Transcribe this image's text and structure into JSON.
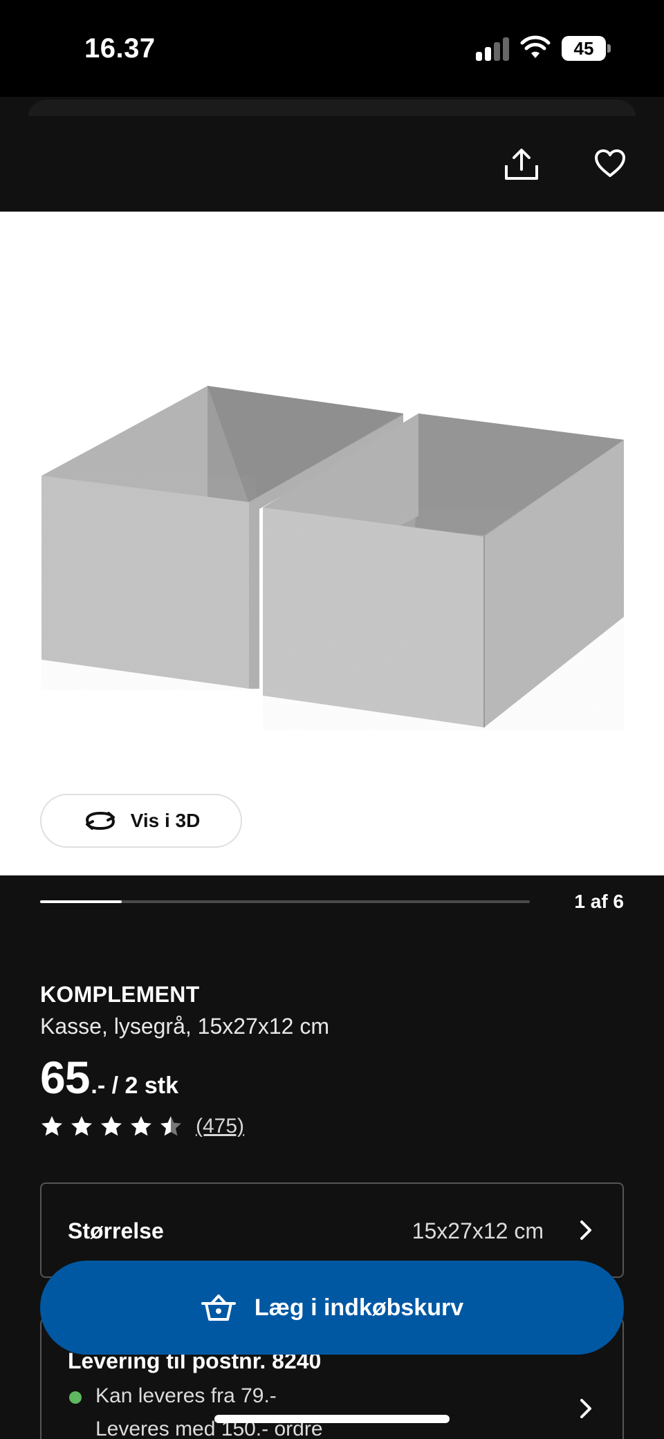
{
  "status_bar": {
    "time": "16.37",
    "battery": "45"
  },
  "gallery": {
    "view_3d_label": "Vis i 3D",
    "counter": "1 af 6",
    "progress": 0.167
  },
  "product": {
    "brand": "KOMPLEMENT",
    "description": "Kasse, lysegrå, 15x27x12 cm",
    "price_integer": "65",
    "price_suffix": ".- / 2 stk",
    "rating": 4.5,
    "review_count": "(475)"
  },
  "size": {
    "label": "Størrelse",
    "value": "15x27x12 cm"
  },
  "delivery": {
    "title": "Levering til postnr. 8240",
    "line1": "Kan leveres fra 79.-",
    "line2": "Leveres med 150.- ordre"
  },
  "cta": {
    "label": "Læg i indkøbskurv"
  },
  "colors": {
    "background": "#111111",
    "accent_blue": "#0058a3",
    "available_green": "#5fb85f"
  },
  "icons": [
    "share-icon",
    "heart-icon",
    "rotate-3d-icon",
    "star-icon",
    "chevron-right-icon",
    "basket-icon"
  ]
}
